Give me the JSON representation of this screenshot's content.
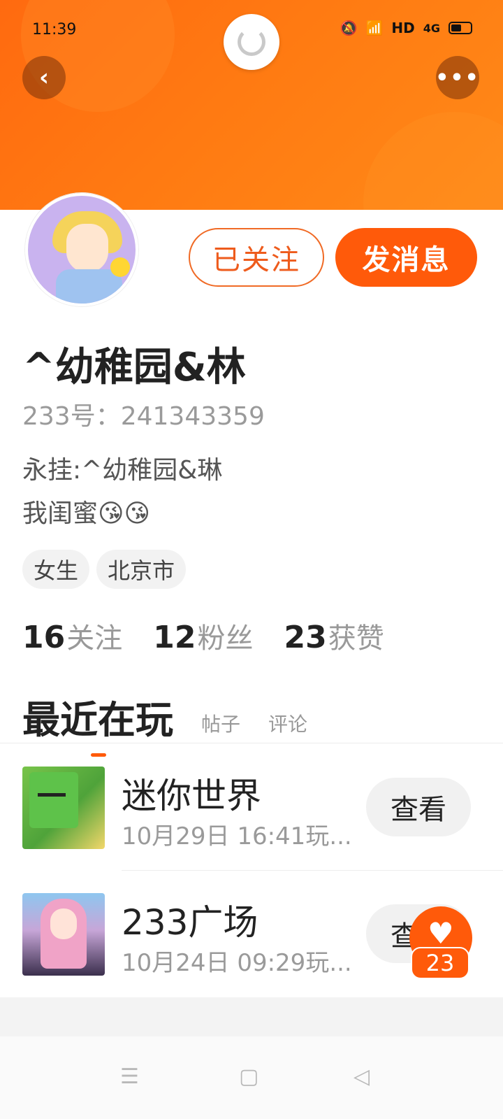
{
  "status_bar": {
    "time": "11:39",
    "network": "HD",
    "signal_type": "4G"
  },
  "header": {
    "back_icon": "chevron-left-icon",
    "more_icon": "more-horizontal-icon",
    "refresh_icon": "refresh-spinner-icon"
  },
  "profile": {
    "username": "^幼稚园&林",
    "id_label": "233号：241343359",
    "bio_line1": "永挂:^幼稚园&琳",
    "bio_line2": "我闺蜜😘😘",
    "tags": [
      "女生",
      "北京市"
    ],
    "followed_label": "已关注",
    "message_label": "发消息"
  },
  "stats": {
    "following_count": "16",
    "following_label": "关注",
    "fans_count": "12",
    "fans_label": "粉丝",
    "likes_count": "23",
    "likes_label": "获赞"
  },
  "tabs": {
    "active": "最近在玩",
    "posts": "帖子",
    "comments": "评论"
  },
  "games": [
    {
      "name": "迷你世界",
      "time": "10月29日 16:41玩...",
      "button": "查看"
    },
    {
      "name": "233广场",
      "time": "10月24日 09:29玩...",
      "button": "查看"
    }
  ],
  "like_fab": {
    "count": "23"
  },
  "colors": {
    "accent": "#ff5a0a",
    "banner": "#ff7a12"
  }
}
